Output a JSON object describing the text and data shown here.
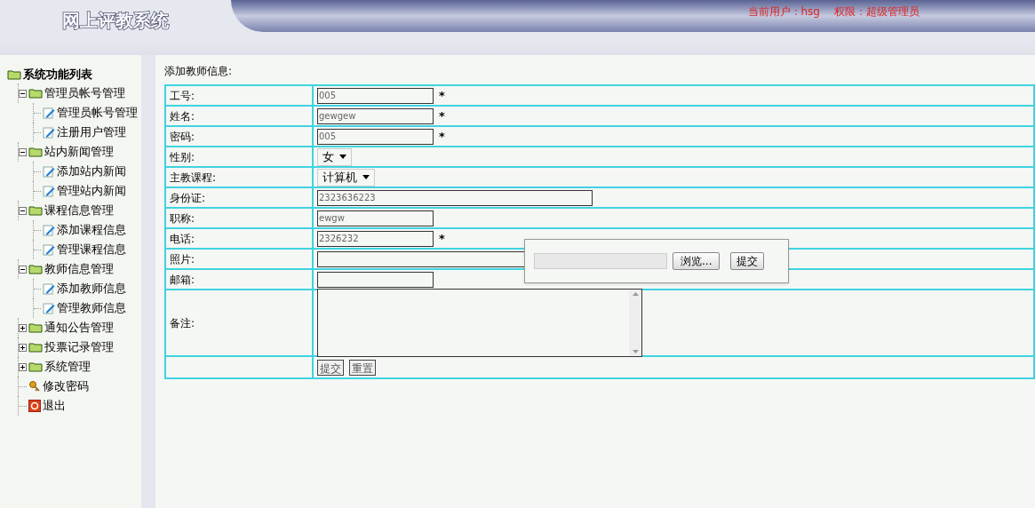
{
  "header": {
    "title": "网上评教系统",
    "user": "当前用户：hsg",
    "role": "权限：超级管理员"
  },
  "sidebar": {
    "root": "系统功能列表",
    "items": [
      {
        "label": "管理员帐号管理",
        "kind": "folder",
        "expanded": true,
        "children": [
          {
            "label": "管理员帐号管理",
            "kind": "page"
          },
          {
            "label": "注册用户管理",
            "kind": "page"
          }
        ]
      },
      {
        "label": "站内新闻管理",
        "kind": "folder",
        "expanded": true,
        "children": [
          {
            "label": "添加站内新闻",
            "kind": "page"
          },
          {
            "label": "管理站内新闻",
            "kind": "page"
          }
        ]
      },
      {
        "label": "课程信息管理",
        "kind": "folder",
        "expanded": true,
        "children": [
          {
            "label": "添加课程信息",
            "kind": "page"
          },
          {
            "label": "管理课程信息",
            "kind": "page"
          }
        ]
      },
      {
        "label": "教师信息管理",
        "kind": "folder",
        "expanded": true,
        "children": [
          {
            "label": "添加教师信息",
            "kind": "page"
          },
          {
            "label": "管理教师信息",
            "kind": "page"
          }
        ]
      },
      {
        "label": "通知公告管理",
        "kind": "folder",
        "expanded": false
      },
      {
        "label": "投票记录管理",
        "kind": "folder",
        "expanded": false
      },
      {
        "label": "系统管理",
        "kind": "folder",
        "expanded": false
      },
      {
        "label": "修改密码",
        "kind": "key"
      },
      {
        "label": "退出",
        "kind": "exit"
      }
    ]
  },
  "form": {
    "heading": "添加教师信息:",
    "required_mark": "*",
    "rows": [
      {
        "label": "工号:",
        "kind": "input",
        "value": "005",
        "required": true
      },
      {
        "label": "姓名:",
        "kind": "input",
        "value": "gewgew",
        "required": true
      },
      {
        "label": "密码:",
        "kind": "input",
        "value": "005",
        "required": true
      },
      {
        "label": "性别:",
        "kind": "select",
        "value": "女"
      },
      {
        "label": "主教课程:",
        "kind": "select",
        "value": "计算机"
      },
      {
        "label": "身份证:",
        "kind": "input_wide",
        "value": "2323636223"
      },
      {
        "label": "职称:",
        "kind": "input",
        "value": "ewgw"
      },
      {
        "label": "电话:",
        "kind": "input",
        "value": "2326232",
        "required": true
      },
      {
        "label": "照片:",
        "kind": "input_wide"
      },
      {
        "label": "邮箱:",
        "kind": "input"
      },
      {
        "label": "备注:",
        "kind": "textarea"
      },
      {
        "kind": "buttons",
        "buttons": [
          "提交",
          "重置"
        ]
      }
    ]
  },
  "upload_popup": {
    "browse": "浏览...",
    "submit": "提交"
  }
}
